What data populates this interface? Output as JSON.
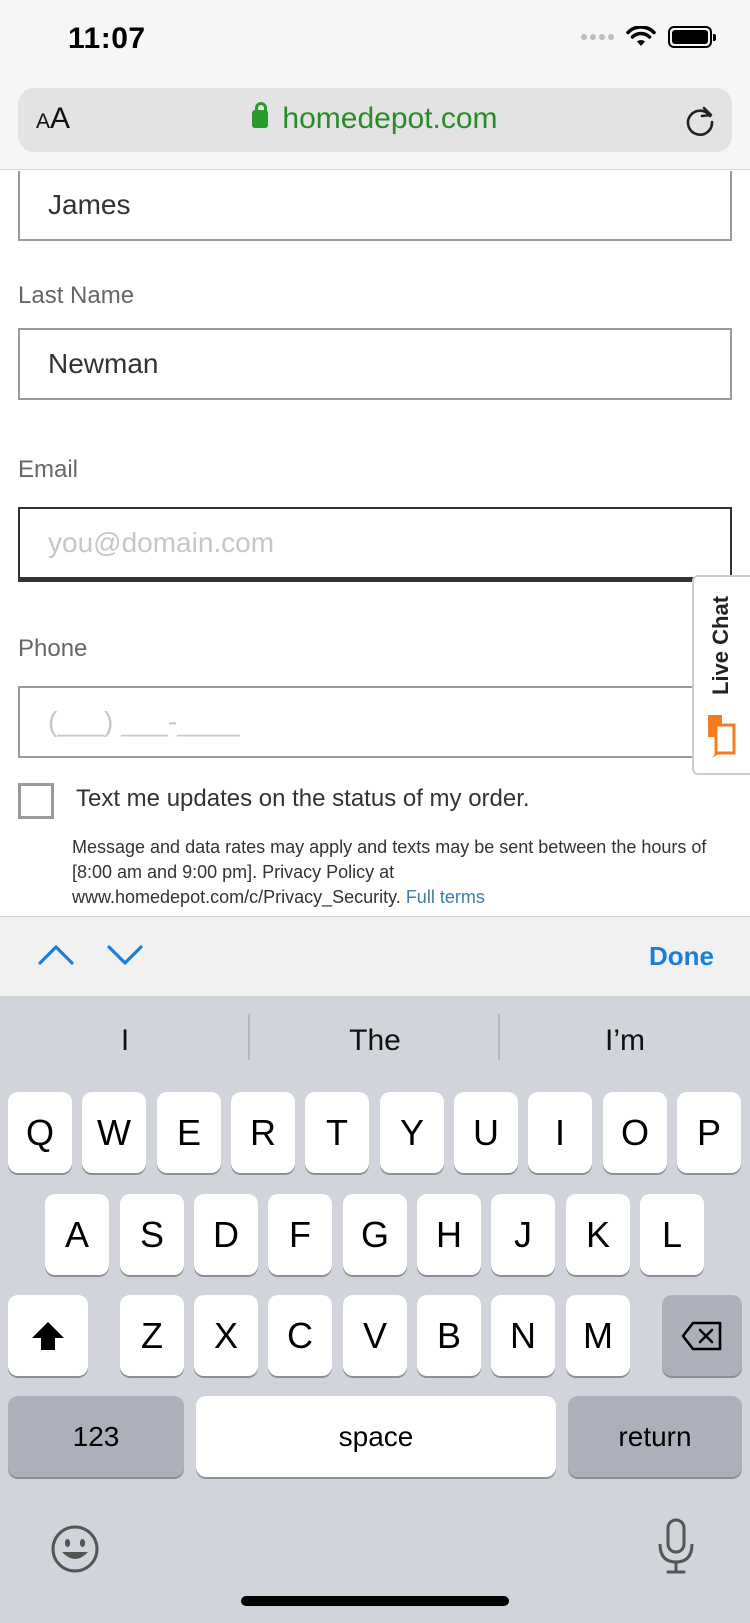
{
  "status_bar": {
    "time": "11:07"
  },
  "address_bar": {
    "text_size_small": "A",
    "text_size_large": "A",
    "url": "homedepot.com"
  },
  "form": {
    "first_name_value": "James",
    "last_name_label": "Last Name",
    "last_name_value": "Newman",
    "email_label": "Email",
    "email_placeholder": "you@domain.com",
    "phone_label": "Phone",
    "phone_placeholder": "(___) ___-____",
    "sms_opt_in_label": "Text me updates on the status of my order.",
    "sms_opt_in_checked": false,
    "fine_print": "Message and data rates may apply and texts may be sent between the hours of [8:00 am and 9:00 pm]. Privacy Policy at www.homedepot.com/c/Privacy_Security.",
    "full_terms_link": "Full terms"
  },
  "live_chat": {
    "label": "Live Chat"
  },
  "accessory_bar": {
    "done_label": "Done"
  },
  "keyboard": {
    "suggestions": [
      "I",
      "The",
      "I’m"
    ],
    "row1": [
      "Q",
      "W",
      "E",
      "R",
      "T",
      "Y",
      "U",
      "I",
      "O",
      "P"
    ],
    "row2": [
      "A",
      "S",
      "D",
      "F",
      "G",
      "H",
      "J",
      "K",
      "L"
    ],
    "row3": [
      "Z",
      "X",
      "C",
      "V",
      "B",
      "N",
      "M"
    ],
    "numbers_key": "123",
    "space_key": "space",
    "return_key": "return"
  },
  "colors": {
    "url_green": "#2a8a2a",
    "link_blue": "#3d7fa8",
    "done_blue": "#1c7fd6",
    "live_chat_orange": "#f47b20"
  }
}
